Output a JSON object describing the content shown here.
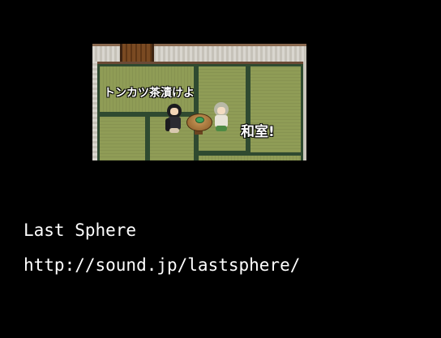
{
  "scene": {
    "speech_left": "トンカツ茶漬けよ",
    "speech_right": "和室!"
  },
  "footer": {
    "title": "Last Sphere",
    "url": "http://sound.jp/lastsphere/"
  },
  "colors": {
    "background": "#000000",
    "tatami": "#8f9c56",
    "tatami_border": "#2f4a30",
    "text": "#ffffff"
  }
}
